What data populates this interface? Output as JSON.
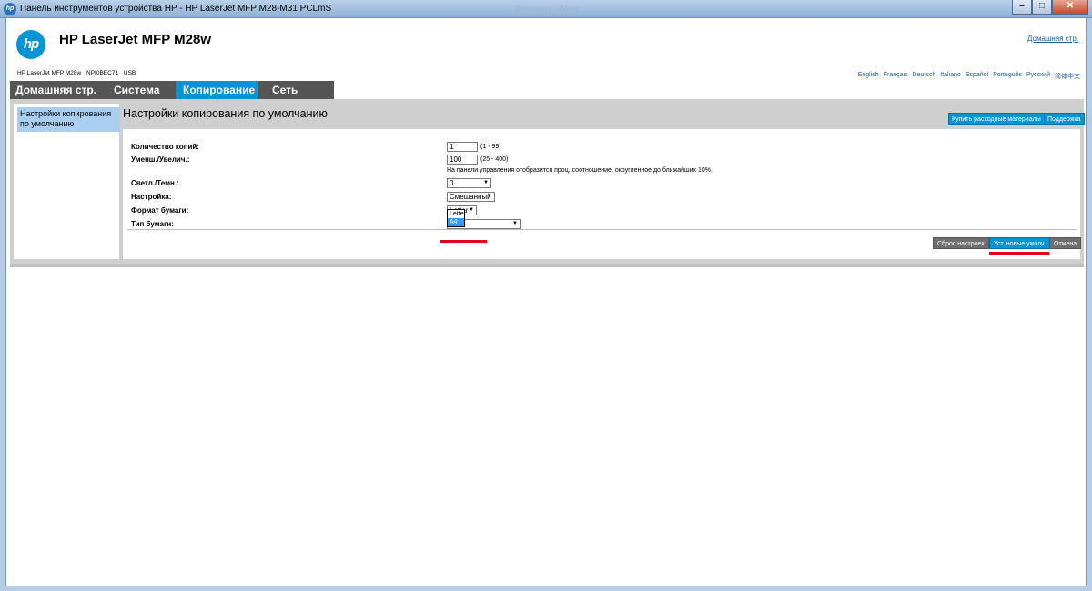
{
  "window": {
    "title": "Панель инструментов устройства HP - HP LaserJet MFP M28-M31 PCLmS",
    "ghost_title": "Документ - Word",
    "min_symbol": "–",
    "max_symbol": "□",
    "close_symbol": "✕"
  },
  "header": {
    "logo_text": "hp",
    "product_title": "HP LaserJet MFP M28w",
    "home_link": "Домашняя стр.",
    "device_model": "HP LaserJet MFP M28w",
    "device_id": "NPI0BEC71",
    "connection": "USB",
    "languages": [
      "English",
      "Français",
      "Deutsch",
      "Italiano",
      "Español",
      "Português",
      "Русский",
      "简体中文"
    ]
  },
  "tabs": [
    {
      "label": "Домашняя стр."
    },
    {
      "label": "Система"
    },
    {
      "label": "Копирование"
    },
    {
      "label": "Сеть"
    }
  ],
  "sidebar": {
    "items": [
      {
        "label": "Настройки копирования по умолчанию"
      }
    ]
  },
  "panel": {
    "title": "Настройки копирования по умолчанию",
    "buy_supplies_button": "Купить расходные материалы",
    "support_button": "Поддержка"
  },
  "form": {
    "copies": {
      "label": "Количество копий:",
      "value": "1",
      "range": "(1 - 99)"
    },
    "reduce_enlarge": {
      "label": "Уменш./Увелич.:",
      "value": "100",
      "range": "(25 - 400)",
      "note": "На панели управления отобразится проц. соотношение, округленное до ближайших 10%."
    },
    "lighter_darker": {
      "label": "Светл./Темн.:",
      "value": "0"
    },
    "optimize": {
      "label": "Настройка:",
      "value": "Смешанный"
    },
    "paper_size": {
      "label": "Формат бумаги:",
      "value": "Letter",
      "options": [
        "Letter",
        "A4"
      ],
      "highlighted": "A4"
    },
    "paper_type": {
      "label": "Тип бумаги:",
      "value": ""
    }
  },
  "actions": {
    "reset": "Сброс настроек",
    "apply": "Уст. новые умолч.",
    "cancel": "Отмена"
  },
  "colors": {
    "hp_blue": "#0096d6",
    "tab_bg": "#555555",
    "highlight_red": "#e2001a",
    "selection_blue": "#3399ff"
  }
}
